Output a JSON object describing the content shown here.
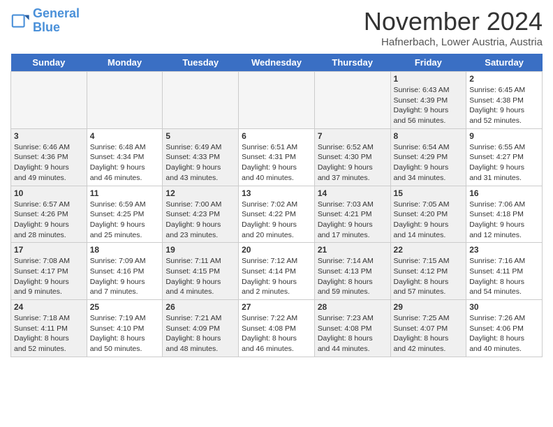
{
  "header": {
    "logo_line1": "General",
    "logo_line2": "Blue",
    "month_title": "November 2024",
    "location": "Hafnerbach, Lower Austria, Austria"
  },
  "days_of_week": [
    "Sunday",
    "Monday",
    "Tuesday",
    "Wednesday",
    "Thursday",
    "Friday",
    "Saturday"
  ],
  "weeks": [
    [
      {
        "day": "",
        "info": "",
        "empty": true
      },
      {
        "day": "",
        "info": "",
        "empty": true
      },
      {
        "day": "",
        "info": "",
        "empty": true
      },
      {
        "day": "",
        "info": "",
        "empty": true
      },
      {
        "day": "",
        "info": "",
        "empty": true
      },
      {
        "day": "1",
        "info": "Sunrise: 6:43 AM\nSunset: 4:39 PM\nDaylight: 9 hours\nand 56 minutes.",
        "shaded": true
      },
      {
        "day": "2",
        "info": "Sunrise: 6:45 AM\nSunset: 4:38 PM\nDaylight: 9 hours\nand 52 minutes."
      }
    ],
    [
      {
        "day": "3",
        "info": "Sunrise: 6:46 AM\nSunset: 4:36 PM\nDaylight: 9 hours\nand 49 minutes.",
        "shaded": true
      },
      {
        "day": "4",
        "info": "Sunrise: 6:48 AM\nSunset: 4:34 PM\nDaylight: 9 hours\nand 46 minutes."
      },
      {
        "day": "5",
        "info": "Sunrise: 6:49 AM\nSunset: 4:33 PM\nDaylight: 9 hours\nand 43 minutes.",
        "shaded": true
      },
      {
        "day": "6",
        "info": "Sunrise: 6:51 AM\nSunset: 4:31 PM\nDaylight: 9 hours\nand 40 minutes."
      },
      {
        "day": "7",
        "info": "Sunrise: 6:52 AM\nSunset: 4:30 PM\nDaylight: 9 hours\nand 37 minutes.",
        "shaded": true
      },
      {
        "day": "8",
        "info": "Sunrise: 6:54 AM\nSunset: 4:29 PM\nDaylight: 9 hours\nand 34 minutes.",
        "shaded": true
      },
      {
        "day": "9",
        "info": "Sunrise: 6:55 AM\nSunset: 4:27 PM\nDaylight: 9 hours\nand 31 minutes."
      }
    ],
    [
      {
        "day": "10",
        "info": "Sunrise: 6:57 AM\nSunset: 4:26 PM\nDaylight: 9 hours\nand 28 minutes.",
        "shaded": true
      },
      {
        "day": "11",
        "info": "Sunrise: 6:59 AM\nSunset: 4:25 PM\nDaylight: 9 hours\nand 25 minutes."
      },
      {
        "day": "12",
        "info": "Sunrise: 7:00 AM\nSunset: 4:23 PM\nDaylight: 9 hours\nand 23 minutes.",
        "shaded": true
      },
      {
        "day": "13",
        "info": "Sunrise: 7:02 AM\nSunset: 4:22 PM\nDaylight: 9 hours\nand 20 minutes."
      },
      {
        "day": "14",
        "info": "Sunrise: 7:03 AM\nSunset: 4:21 PM\nDaylight: 9 hours\nand 17 minutes.",
        "shaded": true
      },
      {
        "day": "15",
        "info": "Sunrise: 7:05 AM\nSunset: 4:20 PM\nDaylight: 9 hours\nand 14 minutes.",
        "shaded": true
      },
      {
        "day": "16",
        "info": "Sunrise: 7:06 AM\nSunset: 4:18 PM\nDaylight: 9 hours\nand 12 minutes."
      }
    ],
    [
      {
        "day": "17",
        "info": "Sunrise: 7:08 AM\nSunset: 4:17 PM\nDaylight: 9 hours\nand 9 minutes.",
        "shaded": true
      },
      {
        "day": "18",
        "info": "Sunrise: 7:09 AM\nSunset: 4:16 PM\nDaylight: 9 hours\nand 7 minutes."
      },
      {
        "day": "19",
        "info": "Sunrise: 7:11 AM\nSunset: 4:15 PM\nDaylight: 9 hours\nand 4 minutes.",
        "shaded": true
      },
      {
        "day": "20",
        "info": "Sunrise: 7:12 AM\nSunset: 4:14 PM\nDaylight: 9 hours\nand 2 minutes."
      },
      {
        "day": "21",
        "info": "Sunrise: 7:14 AM\nSunset: 4:13 PM\nDaylight: 8 hours\nand 59 minutes.",
        "shaded": true
      },
      {
        "day": "22",
        "info": "Sunrise: 7:15 AM\nSunset: 4:12 PM\nDaylight: 8 hours\nand 57 minutes.",
        "shaded": true
      },
      {
        "day": "23",
        "info": "Sunrise: 7:16 AM\nSunset: 4:11 PM\nDaylight: 8 hours\nand 54 minutes."
      }
    ],
    [
      {
        "day": "24",
        "info": "Sunrise: 7:18 AM\nSunset: 4:11 PM\nDaylight: 8 hours\nand 52 minutes.",
        "shaded": true
      },
      {
        "day": "25",
        "info": "Sunrise: 7:19 AM\nSunset: 4:10 PM\nDaylight: 8 hours\nand 50 minutes."
      },
      {
        "day": "26",
        "info": "Sunrise: 7:21 AM\nSunset: 4:09 PM\nDaylight: 8 hours\nand 48 minutes.",
        "shaded": true
      },
      {
        "day": "27",
        "info": "Sunrise: 7:22 AM\nSunset: 4:08 PM\nDaylight: 8 hours\nand 46 minutes."
      },
      {
        "day": "28",
        "info": "Sunrise: 7:23 AM\nSunset: 4:08 PM\nDaylight: 8 hours\nand 44 minutes.",
        "shaded": true
      },
      {
        "day": "29",
        "info": "Sunrise: 7:25 AM\nSunset: 4:07 PM\nDaylight: 8 hours\nand 42 minutes.",
        "shaded": true
      },
      {
        "day": "30",
        "info": "Sunrise: 7:26 AM\nSunset: 4:06 PM\nDaylight: 8 hours\nand 40 minutes."
      }
    ]
  ]
}
